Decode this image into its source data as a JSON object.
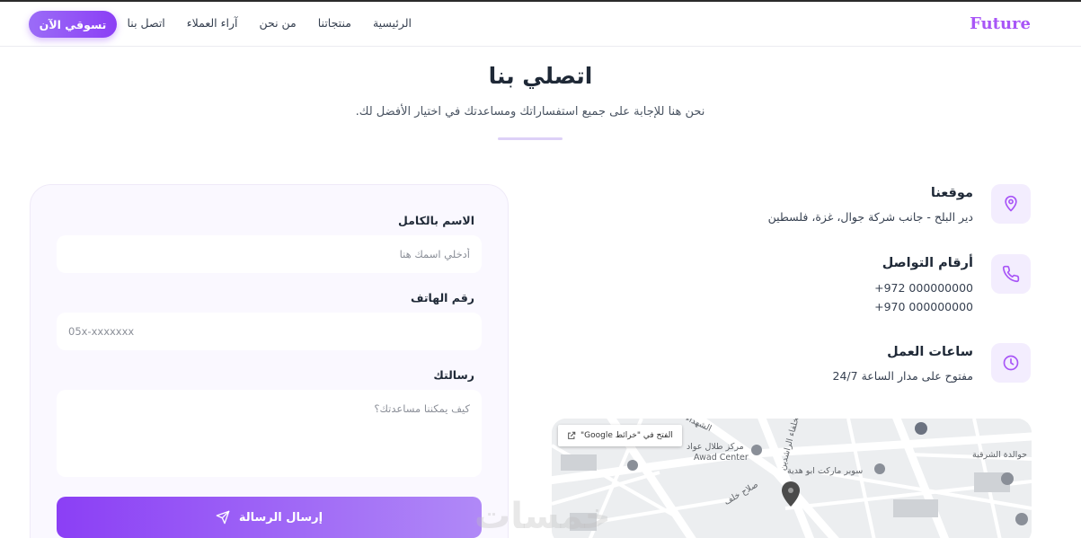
{
  "navbar": {
    "logo": "Future",
    "links": [
      "الرئيسية",
      "منتجاتنا",
      "من نحن",
      "آراء العملاء",
      "اتصل بنا"
    ],
    "cta": "تسوقي الآن"
  },
  "hero": {
    "title": "اتصلي بنا",
    "subtitle": "نحن هنا للإجابة على جميع استفساراتك ومساعدتك في اختيار الأفضل لك."
  },
  "form": {
    "name_label": "الاسم بالكامل",
    "name_placeholder": "أدخلي اسمك هنا",
    "phone_label": "رقم الهاتف",
    "phone_placeholder": "05x-xxxxxxx",
    "message_label": "رسالتك",
    "message_placeholder": "كيف يمكننا مساعدتك؟",
    "submit": "إرسال الرسالة"
  },
  "contact": {
    "location": {
      "title": "موقعنا",
      "lines": [
        "دير البلح - جانب شركة جوال، غزة، فلسطين"
      ],
      "icon": "map-pin-icon"
    },
    "phones": {
      "title": "أرقام التواصل",
      "lines": [
        "+972 000000000",
        "+970 000000000"
      ],
      "icon": "phone-icon"
    },
    "hours": {
      "title": "ساعات العمل",
      "lines": [
        "مفتوح على مدار الساعة 24/7"
      ],
      "icon": "clock-icon"
    }
  },
  "map": {
    "open_link": "الفتح في \"خرائط Google\"",
    "labels": [
      "مركز طلال عواد",
      "Awad Center",
      "سوبر ماركت ابو هدية",
      "حوالدة الشرقية",
      "الشهداء",
      "الخلفاء الراشدين",
      "صلاح خلف"
    ]
  },
  "watermark": "خمسات",
  "colors": {
    "accent": "#a855f7",
    "button": "#8b3ff5",
    "icon_bg": "#f3edfe",
    "card_bg": "#faf8ff"
  }
}
